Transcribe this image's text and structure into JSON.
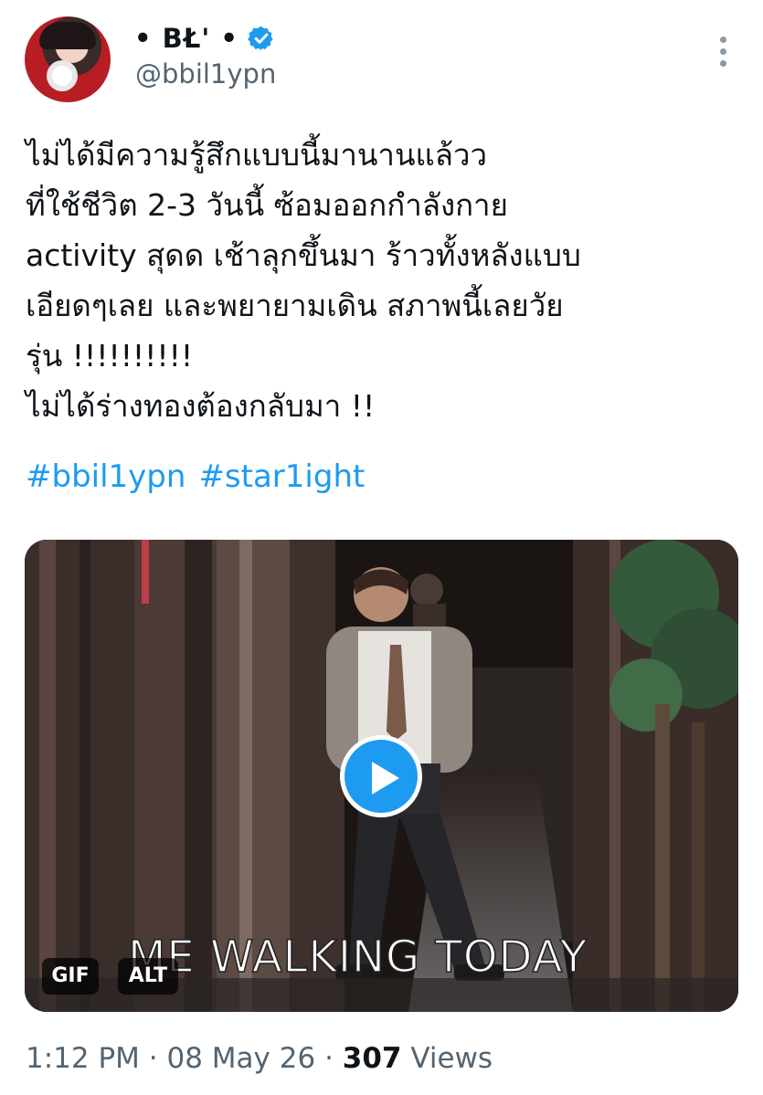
{
  "author": {
    "display_name": "• BŁ' •",
    "handle": "@bbil1ypn",
    "verified": true,
    "avatar_icon": "profile-photo"
  },
  "tweet": {
    "lines": [
      "ไม่ได้มีความรู้สึกแบบนี้มานานแล้วว",
      "ที่ใช้ชีวิต 2-3 วันนี้ ซ้อมออกกำลังกาย",
      "activity สุดด เช้าลุกขึ้นมา ร้าวทั้งหลังแบบ",
      "เอียดๆเลย และพยายามเดิน สภาพนี้เลยวัย",
      "รุ่น !!!!!!!!!!",
      "ไม่ได้ร่างทองต้องกลับมา !!"
    ],
    "hashtags": [
      "#bbil1ypn",
      "#star1ight"
    ]
  },
  "media": {
    "caption": "ME WALKING TODAY",
    "gif_badge": "GIF",
    "alt_badge": "ALT",
    "play_icon": "play-icon"
  },
  "meta": {
    "time": "1:12 PM",
    "date": "08 May 26",
    "separator": "·",
    "views_count": "307",
    "views_label": "Views"
  },
  "colors": {
    "link": "#1d9bf0",
    "secondary": "#536471",
    "primary_text": "#0f1419",
    "verified": "#1d9bf0"
  }
}
